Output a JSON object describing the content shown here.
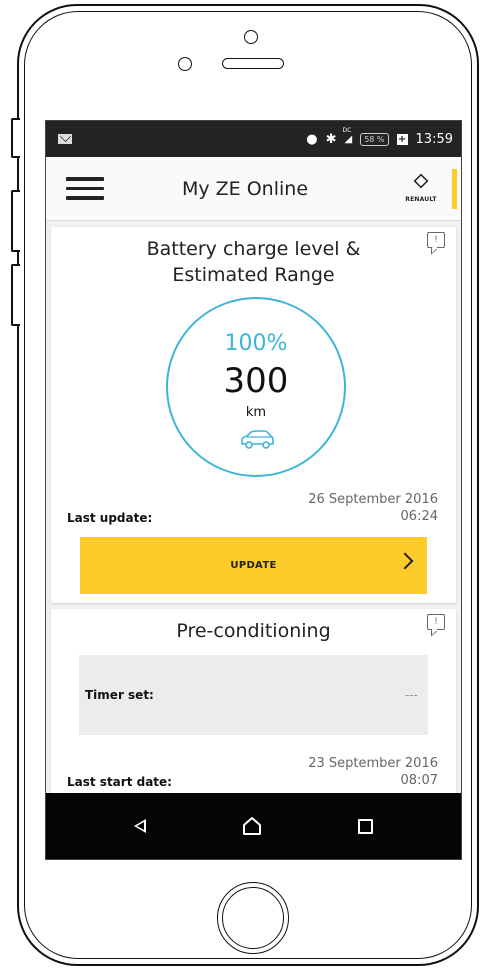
{
  "status_bar": {
    "battery_percent": "58 %",
    "time": "13:59",
    "network_label": "DC"
  },
  "app_bar": {
    "title": "My ZE Online",
    "logo_text": "RENAULT"
  },
  "battery_card": {
    "title_line1": "Battery charge level &",
    "title_line2": "Estimated Range",
    "charge_percent": "100%",
    "charge_level": 1.0,
    "range_value": "300",
    "range_unit": "km",
    "last_update_label": "Last update:",
    "last_update_date": "26 September 2016",
    "last_update_time": "06:24",
    "update_button_label": "UPDATE"
  },
  "precond_card": {
    "title": "Pre-conditioning",
    "timer_label": "Timer set:",
    "timer_value": "---",
    "last_start_label": "Last start date:",
    "last_start_date": "23 September 2016",
    "last_start_time": "08:07"
  },
  "colors": {
    "accent_yellow": "#fccc2a",
    "gauge_blue": "#3bb6d8",
    "nav_bar": "#050505"
  },
  "icons": [
    "mail-icon",
    "location-icon",
    "bluetooth-icon",
    "signal-icon",
    "battery-icon",
    "menu-icon",
    "renault-logo",
    "info-icon",
    "car-icon",
    "chevron-right-icon",
    "back-icon",
    "home-icon",
    "recent-apps-icon"
  ]
}
